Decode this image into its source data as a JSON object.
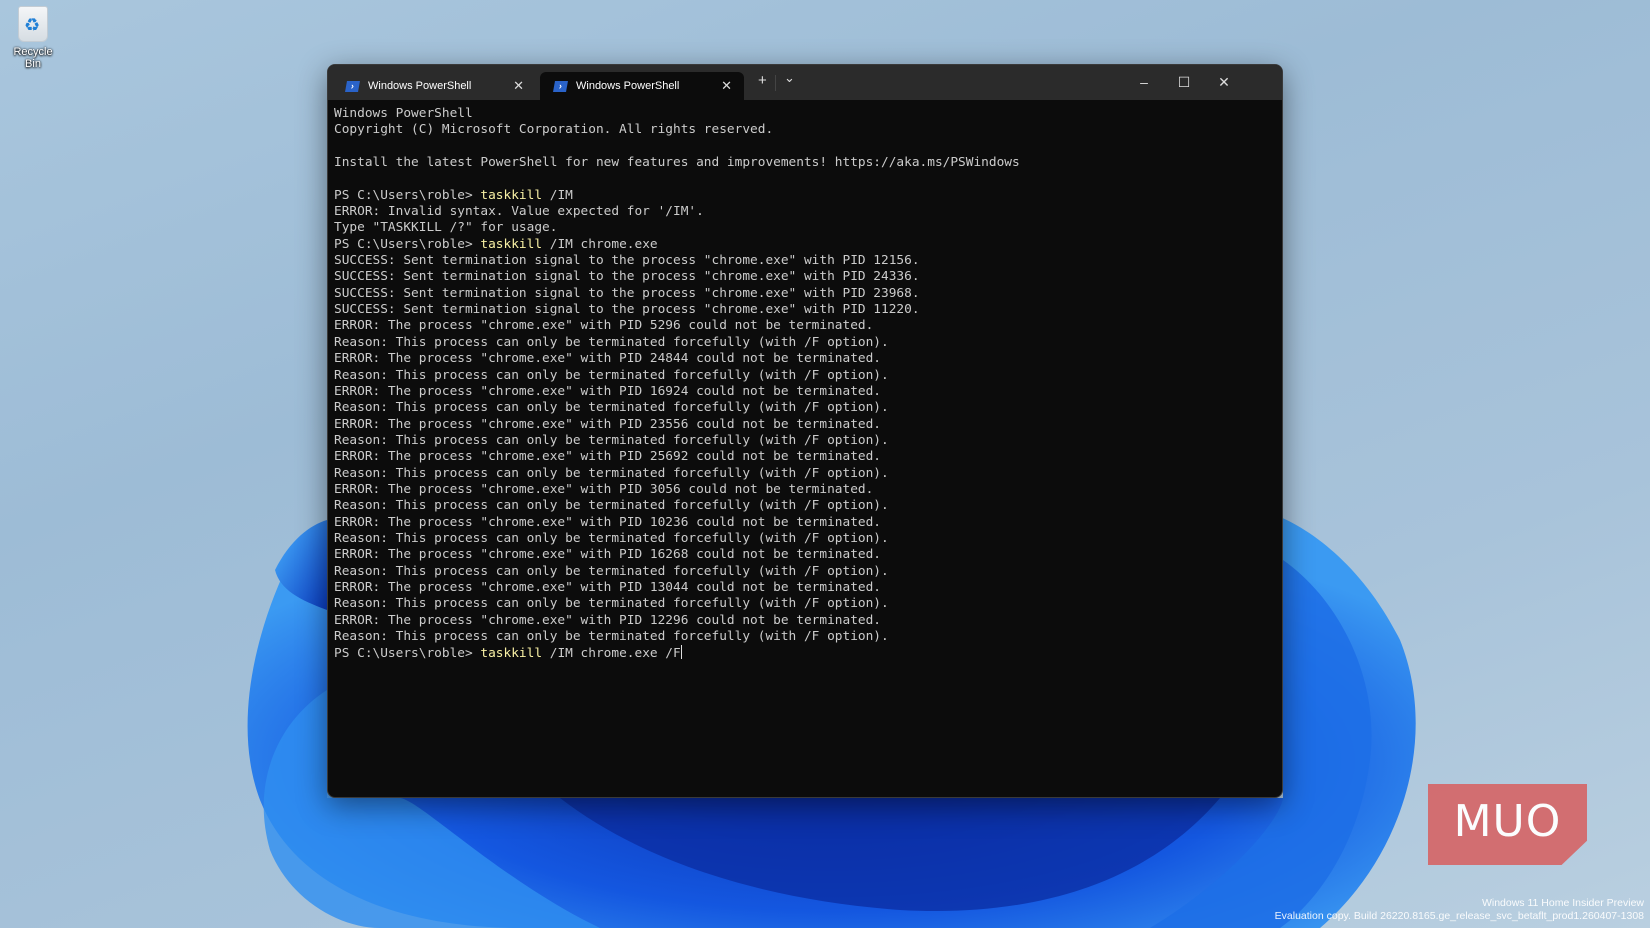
{
  "desktop": {
    "recycle_bin_label": "Recycle Bin",
    "watermark": {
      "line1": "Windows 11 Home Insider Preview",
      "line2": "Evaluation copy. Build 26220.8165.ge_release_svc_betaflt_prod1.260407-1308"
    },
    "logo": "MUO"
  },
  "terminal": {
    "tabs": [
      {
        "label": "Windows PowerShell",
        "active": false
      },
      {
        "label": "Windows PowerShell",
        "active": true
      }
    ],
    "new_tab": "+",
    "dropdown": "⌄",
    "window_controls": {
      "minimize": "–",
      "maximize": "☐",
      "close": "✕"
    },
    "lines": [
      {
        "text": "Windows PowerShell"
      },
      {
        "text": "Copyright (C) Microsoft Corporation. All rights reserved."
      },
      {
        "text": ""
      },
      {
        "text": "Install the latest PowerShell for new features and improvements! https://aka.ms/PSWindows"
      },
      {
        "text": ""
      },
      {
        "prompt": "PS C:\\Users\\roble> ",
        "cmd": "taskkill",
        "args": " /IM"
      },
      {
        "text": "ERROR: Invalid syntax. Value expected for '/IM'."
      },
      {
        "text": "Type \"TASKKILL /?\" for usage."
      },
      {
        "prompt": "PS C:\\Users\\roble> ",
        "cmd": "taskkill",
        "args": " /IM chrome.exe"
      },
      {
        "text": "SUCCESS: Sent termination signal to the process \"chrome.exe\" with PID 12156."
      },
      {
        "text": "SUCCESS: Sent termination signal to the process \"chrome.exe\" with PID 24336."
      },
      {
        "text": "SUCCESS: Sent termination signal to the process \"chrome.exe\" with PID 23968."
      },
      {
        "text": "SUCCESS: Sent termination signal to the process \"chrome.exe\" with PID 11220."
      },
      {
        "text": "ERROR: The process \"chrome.exe\" with PID 5296 could not be terminated."
      },
      {
        "text": "Reason: This process can only be terminated forcefully (with /F option)."
      },
      {
        "text": "ERROR: The process \"chrome.exe\" with PID 24844 could not be terminated."
      },
      {
        "text": "Reason: This process can only be terminated forcefully (with /F option)."
      },
      {
        "text": "ERROR: The process \"chrome.exe\" with PID 16924 could not be terminated."
      },
      {
        "text": "Reason: This process can only be terminated forcefully (with /F option)."
      },
      {
        "text": "ERROR: The process \"chrome.exe\" with PID 23556 could not be terminated."
      },
      {
        "text": "Reason: This process can only be terminated forcefully (with /F option)."
      },
      {
        "text": "ERROR: The process \"chrome.exe\" with PID 25692 could not be terminated."
      },
      {
        "text": "Reason: This process can only be terminated forcefully (with /F option)."
      },
      {
        "text": "ERROR: The process \"chrome.exe\" with PID 3056 could not be terminated."
      },
      {
        "text": "Reason: This process can only be terminated forcefully (with /F option)."
      },
      {
        "text": "ERROR: The process \"chrome.exe\" with PID 10236 could not be terminated."
      },
      {
        "text": "Reason: This process can only be terminated forcefully (with /F option)."
      },
      {
        "text": "ERROR: The process \"chrome.exe\" with PID 16268 could not be terminated."
      },
      {
        "text": "Reason: This process can only be terminated forcefully (with /F option)."
      },
      {
        "text": "ERROR: The process \"chrome.exe\" with PID 13044 could not be terminated."
      },
      {
        "text": "Reason: This process can only be terminated forcefully (with /F option)."
      },
      {
        "text": "ERROR: The process \"chrome.exe\" with PID 12296 could not be terminated."
      },
      {
        "text": "Reason: This process can only be terminated forcefully (with /F option)."
      },
      {
        "prompt": "PS C:\\Users\\roble> ",
        "cmd": "taskkill",
        "args": " /IM chrome.exe /F",
        "current": true
      }
    ]
  }
}
